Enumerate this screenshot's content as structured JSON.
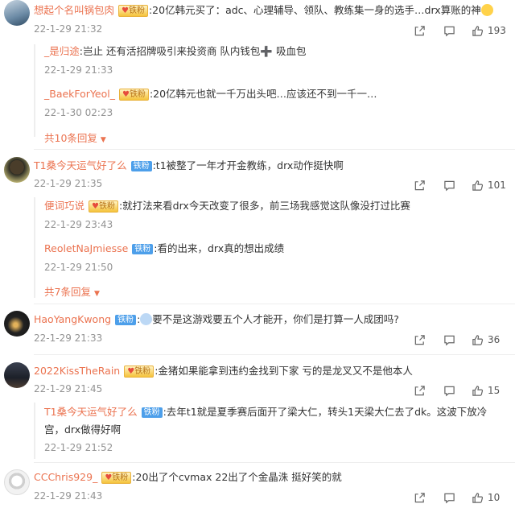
{
  "comments": [
    {
      "username": "想起个名叫锅包肉",
      "badge": "铁粉",
      "text": ":20亿韩元买了：adc、心理辅导、领队、教练集一身的选手…drx算账的神",
      "time": "22-1-29 21:32",
      "likes": "193",
      "replies": [
        {
          "username": "_是归途",
          "badge": "",
          "text": ":岂止 还有活招牌吸引来投资商 队内钱包➕ 吸血包",
          "time": "22-1-29 21:33"
        },
        {
          "username": "_BaekForYeol_",
          "badge": "铁粉",
          "text": ":20亿韩元也就一千万出头吧…应该还不到一千一…",
          "time": "22-1-30 02:23"
        }
      ],
      "more": "共10条回复"
    },
    {
      "username": "T1桑今天运气好了么",
      "badge": "铁粉",
      "text": ":t1被整了一年才开金教练，drx动作挺快啊",
      "time": "22-1-29 21:35",
      "likes": "101",
      "replies": [
        {
          "username": "便词巧说",
          "badge": "铁粉",
          "text": ":就打法来看drx今天改变了很多，前三场我感觉这队像没打过比赛",
          "time": "22-1-29 23:43"
        },
        {
          "username": "ReoletNaJmiesse",
          "badge": "铁粉",
          "text": ":看的出来，drx真的想出成绩",
          "time": "22-1-29 21:50"
        }
      ],
      "more": "共7条回复"
    },
    {
      "username": "HaoYangKwong",
      "badge": "铁粉",
      "text": "要不是这游戏要五个人才能开，你们是打算一人成团吗?",
      "time": "22-1-29 21:33",
      "likes": "36",
      "replies": []
    },
    {
      "username": "2022KissTheRain",
      "badge": "铁粉",
      "text": ":金猪如果能拿到违约金找到下家 亏的是龙叉又不是他本人",
      "time": "22-1-29 21:45",
      "likes": "15",
      "replies": [
        {
          "username": "T1桑今天运气好了么",
          "badge": "铁粉",
          "text": ":去年t1就是夏季赛后面开了梁大仁，转头1天梁大仁去了dk。这波下放冷",
          "text2": "宫，drx做得好啊",
          "time": "22-1-29 21:52"
        }
      ]
    },
    {
      "username": "CCChris929_",
      "badge": "铁粉",
      "text": ":20出了个cvmax 22出了个金晶洙 挺好笑的就",
      "time": "22-1-29 21:43",
      "likes": "10",
      "replies": []
    }
  ],
  "colors": {
    "name": "#eb7350",
    "time": "#939393",
    "badge_blue": "#4d9fea",
    "badge_gold": "#f5c33b"
  },
  "icons": [
    "share-icon",
    "comment-icon",
    "like-icon",
    "chevron-down-icon",
    "emoji-icon"
  ]
}
